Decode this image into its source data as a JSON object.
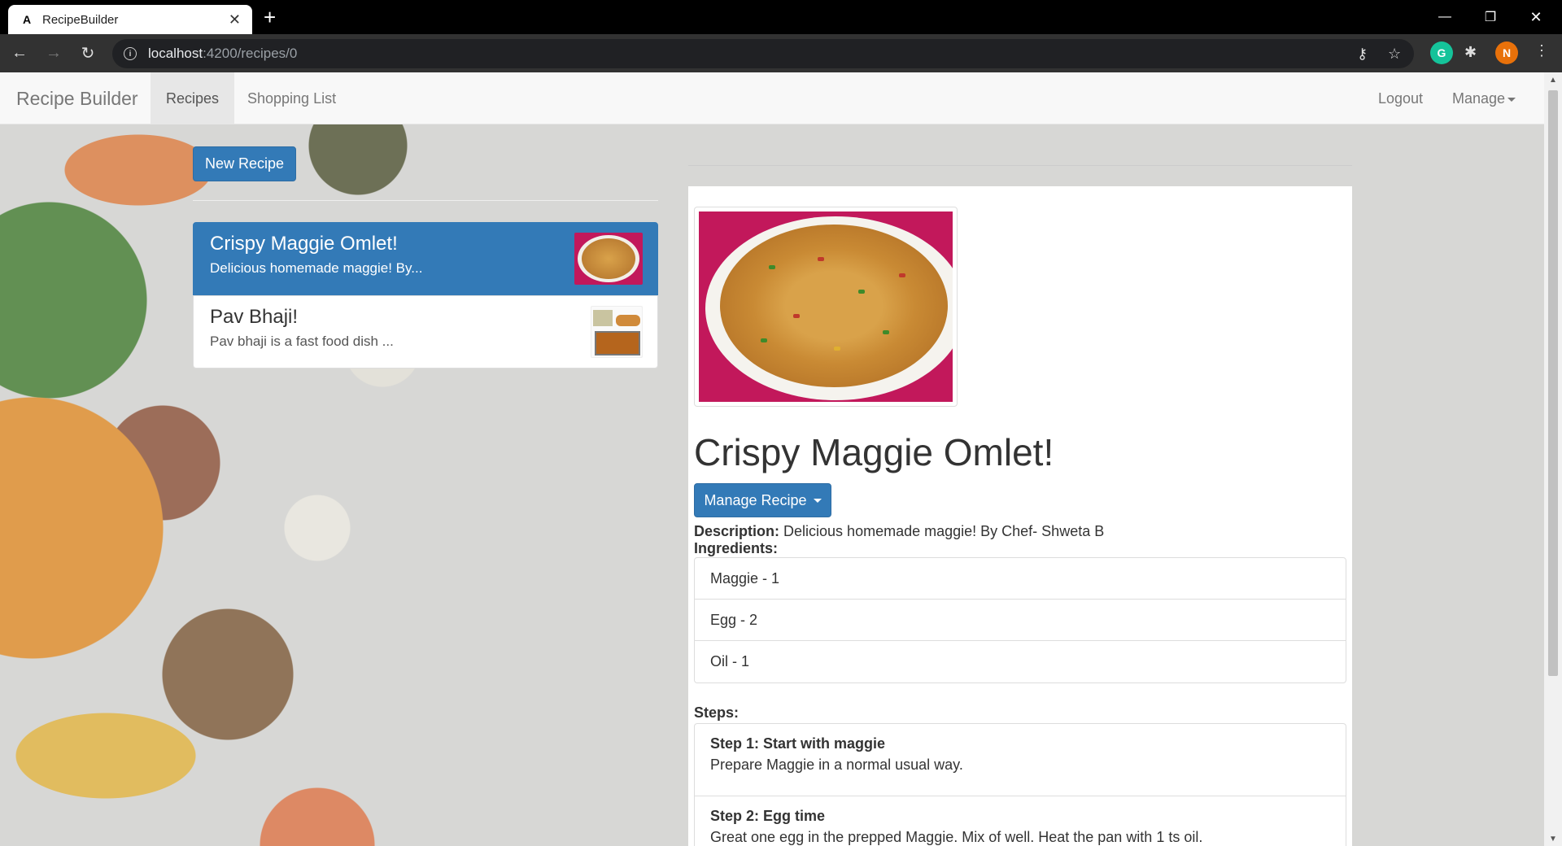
{
  "browser": {
    "tab_title": "RecipeBuilder",
    "favicon": "A",
    "url_host": "localhost",
    "url_path": ":4200/recipes/0",
    "profile_initial": "N",
    "grammarly_initial": "G"
  },
  "navbar": {
    "brand": "Recipe Builder",
    "links": [
      "Recipes",
      "Shopping List"
    ],
    "logout": "Logout",
    "manage": "Manage"
  },
  "sidebar": {
    "new_recipe_button": "New Recipe",
    "recipes": [
      {
        "name": "Crispy Maggie Omlet!",
        "description": "Delicious homemade maggie! By..."
      },
      {
        "name": "Pav Bhaji!",
        "description": "Pav bhaji is a fast food dish ..."
      }
    ]
  },
  "detail": {
    "title": "Crispy Maggie Omlet!",
    "manage_button": "Manage Recipe",
    "description_label": "Description:",
    "description": "Delicious homemade maggie! By Chef- Shweta B",
    "ingredients_label": "Ingredients:",
    "ingredients": [
      "Maggie - 1",
      "Egg - 2",
      "Oil - 1"
    ],
    "steps_label": "Steps:",
    "steps": [
      {
        "title": "Step 1: Start with maggie",
        "text": "Prepare Maggie in a normal usual way."
      },
      {
        "title": "Step 2: Egg time",
        "text": "Great one egg in the prepped Maggie. Mix of well. Heat the pan with 1 ts oil."
      }
    ]
  },
  "colors": {
    "primary": "#337ab7",
    "navbar_bg": "#f8f8f8",
    "photo_bg": "#c2185b"
  },
  "icons": [
    "back-icon",
    "forward-icon",
    "reload-icon",
    "info-icon",
    "key-icon",
    "star-icon",
    "extensions-icon",
    "menu-icon"
  ]
}
